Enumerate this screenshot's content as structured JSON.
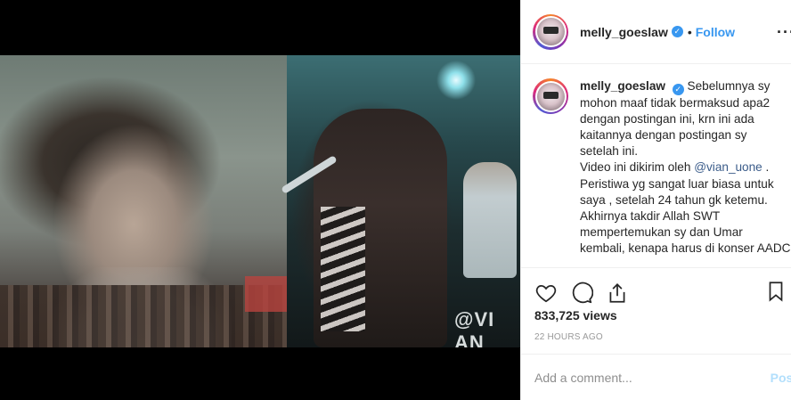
{
  "post": {
    "author": "melly_goeslaw",
    "follow_label": "Follow",
    "dot": "•",
    "more_label": "···",
    "caption_lines": [
      "Sebelumnya sy",
      "mohon maaf tidak bermaksud apa2",
      "dengan postingan ini, krn ini ada",
      "kaitannya dengan postingan sy",
      "setelah ini.",
      "Video ini dikirim oleh ",
      "@vian_uone",
      " .",
      "Peristiwa yg sangat luar biasa untuk",
      "saya , setelah 24 tahun gk ketemu.",
      "Akhirnya takdir Allah SWT",
      "mempertemukan sy dan Umar",
      "kembali, kenapa harus di konser AADC"
    ],
    "views": "833,725 views",
    "timestamp": "22 HOURS AGO",
    "comment_placeholder": "Add a comment...",
    "post_label": "Post"
  },
  "media": {
    "watermark": "@VI AN"
  },
  "icons": {
    "verified": "verified-badge-icon",
    "like": "heart-icon",
    "comment": "comment-bubble-icon",
    "share": "share-icon",
    "save": "bookmark-icon"
  },
  "colors": {
    "accent": "#3897f0",
    "muted": "#999999",
    "border": "#efefef",
    "mention": "#3b5c8a"
  }
}
